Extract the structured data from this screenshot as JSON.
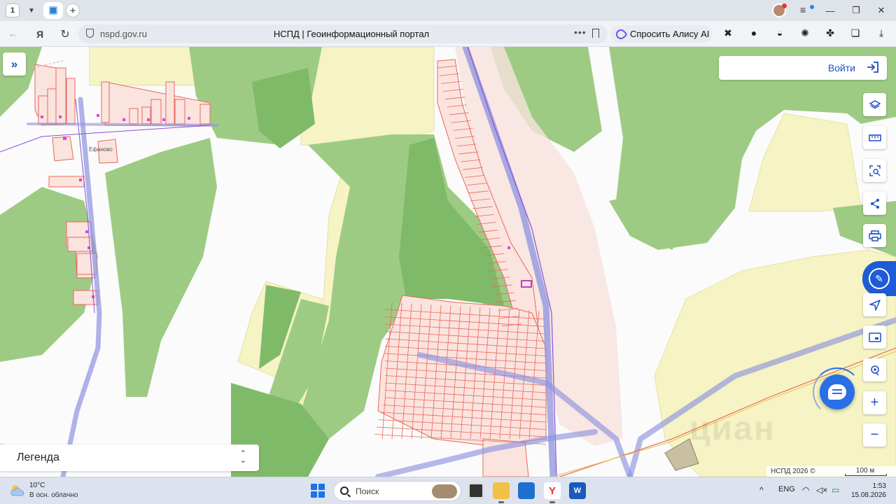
{
  "browser": {
    "tab_count": "1",
    "url": "nspd.gov.ru",
    "page_title": "НСПД | Геоинформационный портал",
    "alisa_label": "Спросить Алису AI"
  },
  "map": {
    "village_label": "Ефаново",
    "login_label": "Войти",
    "legend_label": "Легенда",
    "attribution": "НСПД 2026 ©",
    "scale_label": "100 м",
    "watermark": "циан",
    "colors": {
      "forest": "#9ecb84",
      "forest_dark": "#7fba68",
      "meadow": "#f6f3c4",
      "parcel_fill": "#fbe3de",
      "parcel_line": "#e8685a",
      "road": "#8d93df",
      "accent": "#1e5bd6"
    }
  },
  "taskbar": {
    "weather_temp": "10°C",
    "weather_desc": "В осн. облачно",
    "search_placeholder": "Поиск",
    "language": "ENG",
    "time": "1:53",
    "date": "15.08.2026"
  }
}
